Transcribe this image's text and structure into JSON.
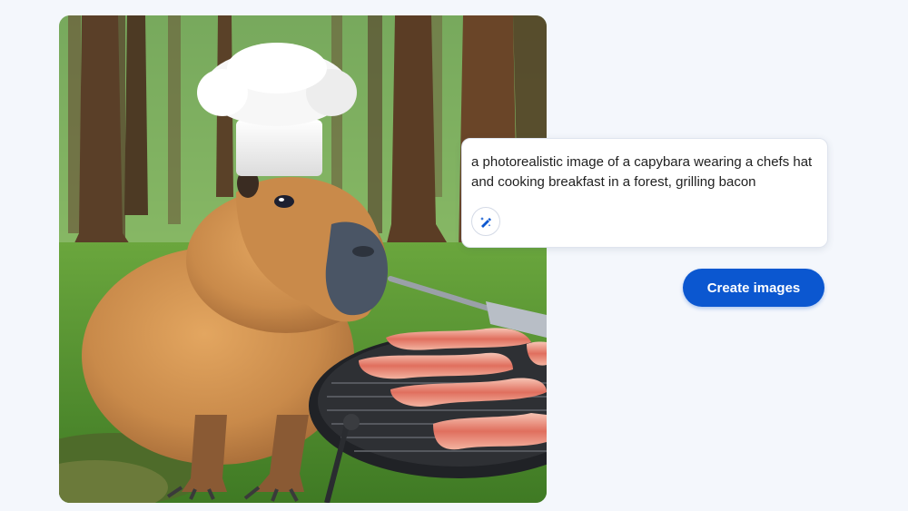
{
  "prompt": {
    "text": "a photorealistic image of a capybara wearing a chefs hat and cooking breakfast in a forest, grilling bacon",
    "edit_icon": "magic-pencil-icon"
  },
  "actions": {
    "create_label": "Create images"
  },
  "colors": {
    "background": "#f4f7fc",
    "primary_button": "#0b57d0",
    "card_bg": "#ffffff"
  }
}
